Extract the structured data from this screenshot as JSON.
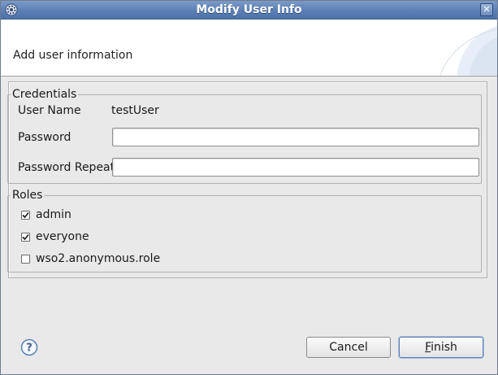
{
  "window": {
    "title": "Modify User Info",
    "close_glyph": "✕",
    "icon": "gear-icon"
  },
  "banner": {
    "message": "Add user information"
  },
  "credentials": {
    "legend": "Credentials",
    "user_name_label": "User Name",
    "user_name_value": "testUser",
    "password_label": "Password",
    "password_value": "",
    "password_repeat_label": "Password Repeat",
    "password_repeat_value": ""
  },
  "roles": {
    "legend": "Roles",
    "items": [
      {
        "label": "admin",
        "checked": true
      },
      {
        "label": "everyone",
        "checked": true
      },
      {
        "label": "wso2.anonymous.role",
        "checked": false
      }
    ]
  },
  "footer": {
    "help_icon": "help-icon",
    "cancel_label": "Cancel",
    "finish_label": "Finish"
  },
  "colors": {
    "titlebar": "#5b7fb5",
    "banner_bg": "#ffffff",
    "dialog_bg": "#e9e9e9"
  }
}
